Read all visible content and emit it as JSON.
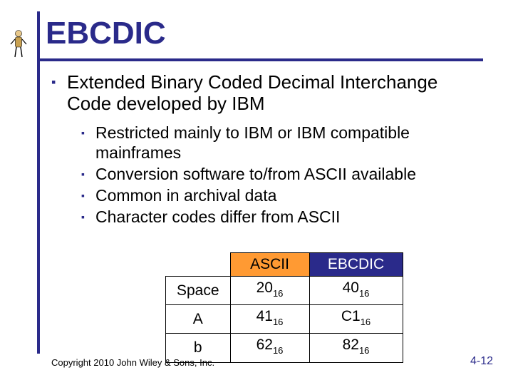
{
  "title": "EBCDIC",
  "bullets": {
    "main": "Extended Binary Coded Decimal Interchange Code developed by IBM",
    "subs": [
      "Restricted mainly to IBM or IBM compatible mainframes",
      "Conversion software to/from ASCII available",
      "Common in archival data",
      "Character codes differ from ASCII"
    ]
  },
  "table": {
    "headers": {
      "col1": "ASCII",
      "col2": "EBCDIC"
    },
    "rows": [
      {
        "label": "Space",
        "ascii_main": "20",
        "ascii_sub": "16",
        "ebcdic_main": "40",
        "ebcdic_sub": "16"
      },
      {
        "label": "A",
        "ascii_main": "41",
        "ascii_sub": "16",
        "ebcdic_main": "C1",
        "ebcdic_sub": "16"
      },
      {
        "label": "b",
        "ascii_main": "62",
        "ascii_sub": "16",
        "ebcdic_main": "82",
        "ebcdic_sub": "16"
      }
    ]
  },
  "footer": {
    "copyright": "Copyright 2010 John Wiley & Sons, Inc.",
    "pagenum": "4-12"
  }
}
